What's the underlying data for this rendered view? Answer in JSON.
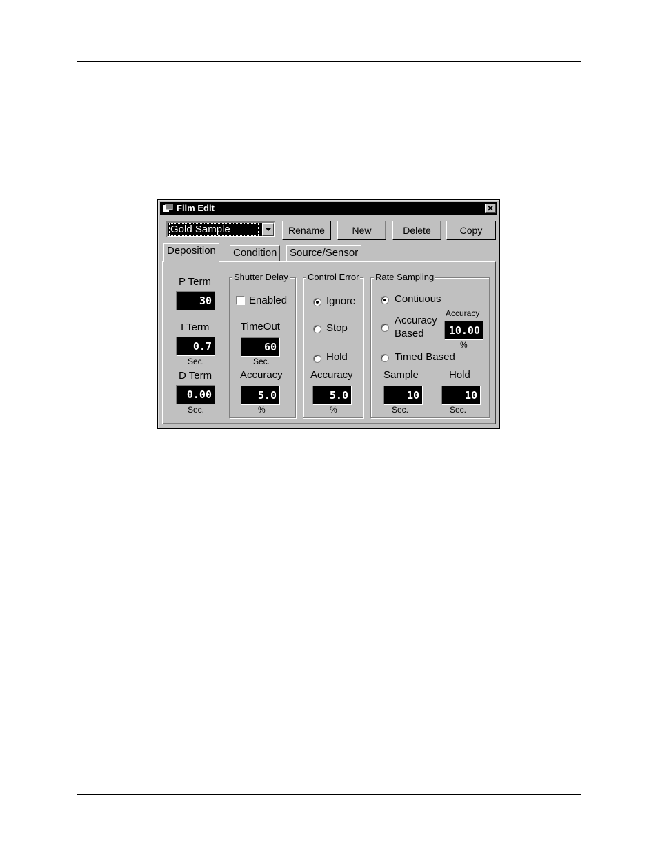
{
  "window": {
    "title": "Film Edit",
    "close_label": "✕"
  },
  "toolbar": {
    "film_select_value": "Gold Sample",
    "rename_label": "Rename",
    "new_label": "New",
    "delete_label": "Delete",
    "copy_label": "Copy"
  },
  "tabs": [
    {
      "label": "Deposition",
      "active": true
    },
    {
      "label": "Condition",
      "active": false
    },
    {
      "label": "Source/Sensor",
      "active": false
    }
  ],
  "deposition": {
    "p_term": {
      "label": "P Term",
      "value": "30"
    },
    "i_term": {
      "label": "I Term",
      "value": "0.7",
      "unit": "Sec."
    },
    "d_term": {
      "label": "D Term",
      "value": "0.00",
      "unit": "Sec."
    },
    "shutter_delay": {
      "title": "Shutter Delay",
      "enabled_label": "Enabled",
      "enabled": false,
      "timeout_label": "TimeOut",
      "timeout_value": "60",
      "timeout_unit": "Sec.",
      "accuracy_label": "Accuracy",
      "accuracy_value": "5.0",
      "accuracy_unit": "%"
    },
    "control_error": {
      "title": "Control Error",
      "options": [
        "Ignore",
        "Stop",
        "Hold"
      ],
      "selected": "Ignore",
      "accuracy_label": "Accuracy",
      "accuracy_value": "5.0",
      "accuracy_unit": "%"
    },
    "rate_sampling": {
      "title": "Rate Sampling",
      "option_continuous": "Contiuous",
      "option_accuracy_line1": "Accuracy",
      "option_accuracy_line2": "Based",
      "option_timed": "Timed Based",
      "selected": "Contiuous",
      "accuracy_label": "Accuracy",
      "accuracy_value": "10.00",
      "accuracy_unit": "%",
      "sample_label": "Sample",
      "sample_value": "10",
      "sample_unit": "Sec.",
      "hold_label": "Hold",
      "hold_value": "10",
      "hold_unit": "Sec."
    }
  }
}
